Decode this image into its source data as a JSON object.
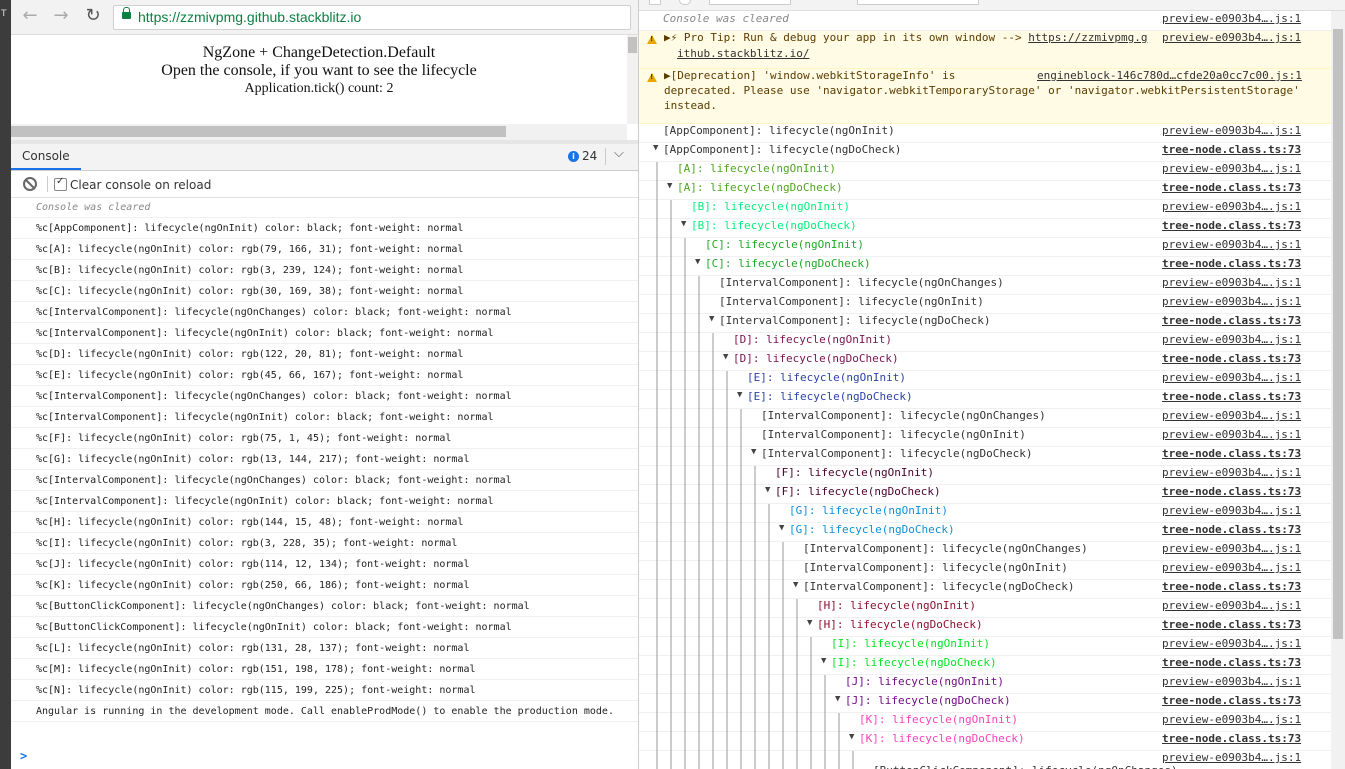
{
  "colors": {
    "black": "#333333",
    "A": "#4fa61f",
    "B": "#03ef7c",
    "C": "#1ea926",
    "D": "#7a1451",
    "E": "#2d42a7",
    "F": "#4b012d",
    "G": "#0d90d9",
    "H": "#900f30",
    "I": "#03e423",
    "J": "#720c86",
    "K": "#fa42ba",
    "L": "#831c89",
    "M": "#97c6b2",
    "N": "#73c7e1",
    "info": "#1a73e8",
    "warn_bg": "#fffbe5"
  },
  "left_edge": {
    "label": "T"
  },
  "browser": {
    "back_icon": "arrow-left-icon",
    "forward_icon": "arrow-right-icon",
    "reload_icon": "reload-icon",
    "lock_icon": "lock-icon",
    "url": "https://zzmivpmg.github.stackblitz.io"
  },
  "page": {
    "title": "NgZone + ChangeDetection.Default",
    "subtitle": "Open the console, if you want to see the lifecycle",
    "tick_count": "Application.tick() count: 2"
  },
  "drawer": {
    "tab_label": "Console",
    "info_count": "24",
    "clear_console_label": "Clear console on reload"
  },
  "left_console": {
    "cleared": "Console was cleared",
    "rows": [
      "%c[AppComponent]: lifecycle(ngOnInit) color: black; font-weight: normal",
      "%c[A]: lifecycle(ngOnInit) color: rgb(79, 166, 31); font-weight: normal",
      "%c[B]: lifecycle(ngOnInit) color: rgb(3, 239, 124); font-weight: normal",
      "%c[C]: lifecycle(ngOnInit) color: rgb(30, 169, 38); font-weight: normal",
      "%c[IntervalComponent]: lifecycle(ngOnChanges) color: black; font-weight: normal",
      "%c[IntervalComponent]: lifecycle(ngOnInit) color: black; font-weight: normal",
      "%c[D]: lifecycle(ngOnInit) color: rgb(122, 20, 81); font-weight: normal",
      "%c[E]: lifecycle(ngOnInit) color: rgb(45, 66, 167); font-weight: normal",
      "%c[IntervalComponent]: lifecycle(ngOnChanges) color: black; font-weight: normal",
      "%c[IntervalComponent]: lifecycle(ngOnInit) color: black; font-weight: normal",
      "%c[F]: lifecycle(ngOnInit) color: rgb(75, 1, 45); font-weight: normal",
      "%c[G]: lifecycle(ngOnInit) color: rgb(13, 144, 217); font-weight: normal",
      "%c[IntervalComponent]: lifecycle(ngOnChanges) color: black; font-weight: normal",
      "%c[IntervalComponent]: lifecycle(ngOnInit) color: black; font-weight: normal",
      "%c[H]: lifecycle(ngOnInit) color: rgb(144, 15, 48); font-weight: normal",
      "%c[I]: lifecycle(ngOnInit) color: rgb(3, 228, 35); font-weight: normal",
      "%c[J]: lifecycle(ngOnInit) color: rgb(114, 12, 134); font-weight: normal",
      "%c[K]: lifecycle(ngOnInit) color: rgb(250, 66, 186); font-weight: normal",
      "%c[ButtonClickComponent]: lifecycle(ngOnChanges) color: black; font-weight: normal",
      "%c[ButtonClickComponent]: lifecycle(ngOnInit) color: black; font-weight: normal",
      "%c[L]: lifecycle(ngOnInit) color: rgb(131, 28, 137); font-weight: normal",
      "%c[M]: lifecycle(ngOnInit) color: rgb(151, 198, 178); font-weight: normal",
      "%c[N]: lifecycle(ngOnInit) color: rgb(115, 199, 225); font-weight: normal",
      "Angular is running in the development mode. Call enableProdMode() to enable the production mode."
    ],
    "prompt": ">"
  },
  "right_console": {
    "cleared": "Console was cleared",
    "cleared_src": "preview-e0903b4….js:1",
    "tip": {
      "line1": "Pro Tip: Run & debug your app in its own window --> ",
      "link1": "https://zzmivpmg.g",
      "link2": "ithub.stackblitz.io/",
      "src": "preview-e0903b4….js:1"
    },
    "deprecation": {
      "line1": "[Deprecation] 'window.webkitStorageInfo' is",
      "line2": "deprecated. Please use 'navigator.webkitTemporaryStorage' or 'navigator.webkitPersistentStorage'",
      "line3": "instead.",
      "src": "engineblock-146c780d…cfde20a0cc7c00.js:1"
    },
    "rows": [
      {
        "text": "[AppComponent]: lifecycle(ngOnInit)",
        "color": "black",
        "depth": 0,
        "tri": false,
        "src": "preview-e0903b4….js:1"
      },
      {
        "text": "[AppComponent]: lifecycle(ngDoCheck)",
        "color": "black",
        "depth": 0,
        "tri": true,
        "src": "tree-node.class.ts:73"
      },
      {
        "text": "[A]: lifecycle(ngOnInit)",
        "color": "A",
        "depth": 1,
        "tri": false,
        "src": "preview-e0903b4….js:1"
      },
      {
        "text": "[A]: lifecycle(ngDoCheck)",
        "color": "A",
        "depth": 1,
        "tri": true,
        "src": "tree-node.class.ts:73"
      },
      {
        "text": "[B]: lifecycle(ngOnInit)",
        "color": "B",
        "depth": 2,
        "tri": false,
        "src": "preview-e0903b4….js:1"
      },
      {
        "text": "[B]: lifecycle(ngDoCheck)",
        "color": "B",
        "depth": 2,
        "tri": true,
        "src": "tree-node.class.ts:73"
      },
      {
        "text": "[C]: lifecycle(ngOnInit)",
        "color": "C",
        "depth": 3,
        "tri": false,
        "src": "preview-e0903b4….js:1"
      },
      {
        "text": "[C]: lifecycle(ngDoCheck)",
        "color": "C",
        "depth": 3,
        "tri": true,
        "src": "tree-node.class.ts:73"
      },
      {
        "text": "[IntervalComponent]: lifecycle(ngOnChanges)",
        "color": "black",
        "depth": 4,
        "tri": false,
        "src": "preview-e0903b4….js:1"
      },
      {
        "text": "[IntervalComponent]: lifecycle(ngOnInit)",
        "color": "black",
        "depth": 4,
        "tri": false,
        "src": "preview-e0903b4….js:1"
      },
      {
        "text": "[IntervalComponent]: lifecycle(ngDoCheck)",
        "color": "black",
        "depth": 4,
        "tri": true,
        "src": "tree-node.class.ts:73"
      },
      {
        "text": "[D]: lifecycle(ngOnInit)",
        "color": "D",
        "depth": 5,
        "tri": false,
        "src": "preview-e0903b4….js:1"
      },
      {
        "text": "[D]: lifecycle(ngDoCheck)",
        "color": "D",
        "depth": 5,
        "tri": true,
        "src": "tree-node.class.ts:73"
      },
      {
        "text": "[E]: lifecycle(ngOnInit)",
        "color": "E",
        "depth": 6,
        "tri": false,
        "src": "preview-e0903b4….js:1"
      },
      {
        "text": "[E]: lifecycle(ngDoCheck)",
        "color": "E",
        "depth": 6,
        "tri": true,
        "src": "tree-node.class.ts:73"
      },
      {
        "text": "[IntervalComponent]: lifecycle(ngOnChanges)",
        "color": "black",
        "depth": 7,
        "tri": false,
        "src": "preview-e0903b4….js:1"
      },
      {
        "text": "[IntervalComponent]: lifecycle(ngOnInit)",
        "color": "black",
        "depth": 7,
        "tri": false,
        "src": "preview-e0903b4….js:1"
      },
      {
        "text": "[IntervalComponent]: lifecycle(ngDoCheck)",
        "color": "black",
        "depth": 7,
        "tri": true,
        "src": "tree-node.class.ts:73"
      },
      {
        "text": "[F]: lifecycle(ngOnInit)",
        "color": "F",
        "depth": 8,
        "tri": false,
        "src": "preview-e0903b4….js:1"
      },
      {
        "text": "[F]: lifecycle(ngDoCheck)",
        "color": "F",
        "depth": 8,
        "tri": true,
        "src": "tree-node.class.ts:73"
      },
      {
        "text": "[G]: lifecycle(ngOnInit)",
        "color": "G",
        "depth": 9,
        "tri": false,
        "src": "preview-e0903b4….js:1"
      },
      {
        "text": "[G]: lifecycle(ngDoCheck)",
        "color": "G",
        "depth": 9,
        "tri": true,
        "src": "tree-node.class.ts:73"
      },
      {
        "text": "[IntervalComponent]: lifecycle(ngOnChanges)",
        "color": "black",
        "depth": 10,
        "tri": false,
        "src": "preview-e0903b4….js:1"
      },
      {
        "text": "[IntervalComponent]: lifecycle(ngOnInit)",
        "color": "black",
        "depth": 10,
        "tri": false,
        "src": "preview-e0903b4….js:1"
      },
      {
        "text": "[IntervalComponent]: lifecycle(ngDoCheck)",
        "color": "black",
        "depth": 10,
        "tri": true,
        "src": "tree-node.class.ts:73"
      },
      {
        "text": "[H]: lifecycle(ngOnInit)",
        "color": "H",
        "depth": 11,
        "tri": false,
        "src": "preview-e0903b4….js:1"
      },
      {
        "text": "[H]: lifecycle(ngDoCheck)",
        "color": "H",
        "depth": 11,
        "tri": true,
        "src": "tree-node.class.ts:73"
      },
      {
        "text": "[I]: lifecycle(ngOnInit)",
        "color": "I",
        "depth": 12,
        "tri": false,
        "src": "preview-e0903b4….js:1"
      },
      {
        "text": "[I]: lifecycle(ngDoCheck)",
        "color": "I",
        "depth": 12,
        "tri": true,
        "src": "tree-node.class.ts:73"
      },
      {
        "text": "[J]: lifecycle(ngOnInit)",
        "color": "J",
        "depth": 13,
        "tri": false,
        "src": "preview-e0903b4….js:1"
      },
      {
        "text": "[J]: lifecycle(ngDoCheck)",
        "color": "J",
        "depth": 13,
        "tri": true,
        "src": "tree-node.class.ts:73"
      },
      {
        "text": "[K]: lifecycle(ngOnInit)",
        "color": "K",
        "depth": 14,
        "tri": false,
        "src": "preview-e0903b4….js:1"
      },
      {
        "text": "[K]: lifecycle(ngDoCheck)",
        "color": "K",
        "depth": 14,
        "tri": true,
        "src": "tree-node.class.ts:73"
      },
      {
        "text": "",
        "color": "black",
        "depth": 15,
        "tri": false,
        "src": "preview-e0903b4….js:1"
      },
      {
        "text": "[ButtonClickComponent]: lifecycle(ngOnChanges)",
        "color": "black",
        "depth": 15,
        "tri": false,
        "src": ""
      }
    ]
  }
}
